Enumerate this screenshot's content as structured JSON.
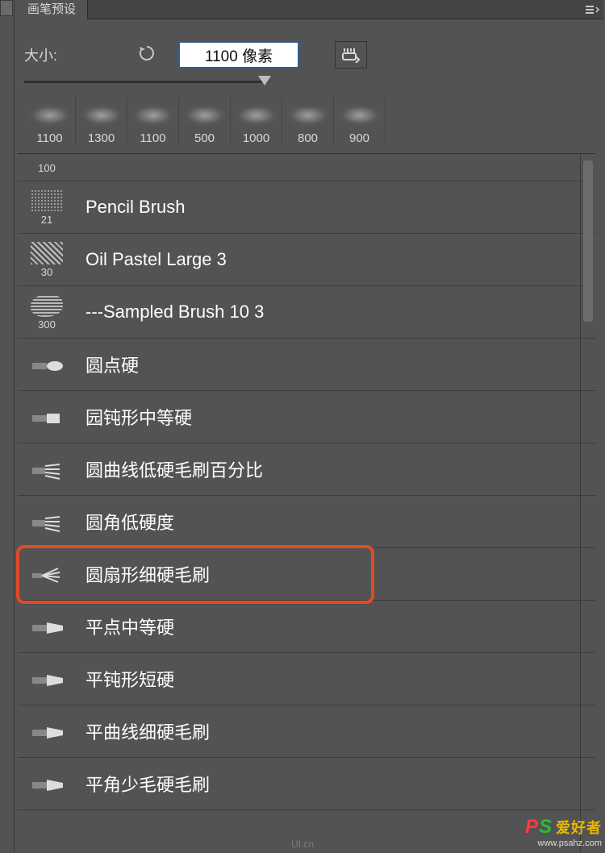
{
  "tab": {
    "title": "画笔预设"
  },
  "size": {
    "label": "大小:",
    "value": "1100 像素"
  },
  "thumbs": [
    "1100",
    "1300",
    "1100",
    "500",
    "1000",
    "800",
    "900"
  ],
  "small_row": {
    "num": "100"
  },
  "brushes": [
    {
      "num": "21",
      "name": "Pencil Brush",
      "swatch": "dots"
    },
    {
      "num": "30",
      "name": "Oil Pastel Large 3",
      "swatch": "scratch"
    },
    {
      "num": "300",
      "name": "---Sampled Brush 10 3",
      "swatch": "lines"
    },
    {
      "num": "",
      "name": "圆点硬",
      "swatch": "tip-round"
    },
    {
      "num": "",
      "name": "园钝形中等硬",
      "swatch": "tip-flat"
    },
    {
      "num": "",
      "name": "圆曲线低硬毛刷百分比",
      "swatch": "tip-bristle"
    },
    {
      "num": "",
      "name": "圆角低硬度",
      "swatch": "tip-bristle"
    },
    {
      "num": "",
      "name": "圆扇形细硬毛刷",
      "swatch": "tip-fan",
      "highlight": true
    },
    {
      "num": "",
      "name": "平点中等硬",
      "swatch": "tip-chisel"
    },
    {
      "num": "",
      "name": "平钝形短硬",
      "swatch": "tip-chisel"
    },
    {
      "num": "",
      "name": "平曲线细硬毛刷",
      "swatch": "tip-chisel"
    },
    {
      "num": "",
      "name": "平角少毛硬毛刷",
      "swatch": "tip-chisel"
    }
  ],
  "watermark": {
    "brand_p": "P",
    "brand_s": "S",
    "brand_cn": "爱好者",
    "url": "www.psahz.com"
  },
  "watermark2": "UI.cn"
}
